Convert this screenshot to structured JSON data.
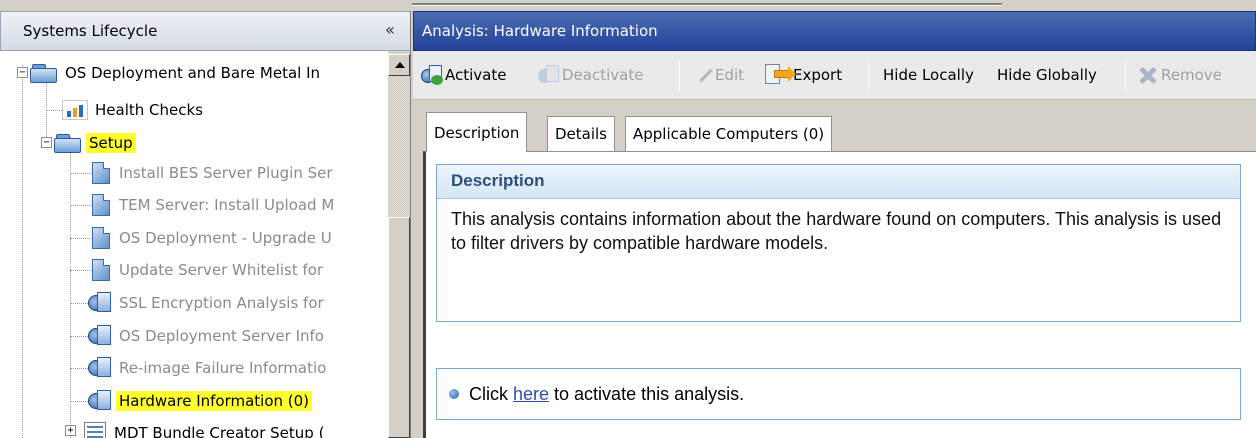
{
  "left_panel": {
    "title": "Systems Lifecycle",
    "collapse_glyph": "«",
    "tree": [
      {
        "label": "OS Deployment and Bare Metal In",
        "icon": "folder-icon",
        "expander": "−",
        "disabled": false,
        "highlight": false
      },
      {
        "label": "Health Checks",
        "icon": "chart-icon",
        "disabled": false,
        "highlight": false
      },
      {
        "label": "Setup",
        "icon": "folder-icon",
        "expander": "−",
        "disabled": false,
        "highlight": true
      },
      {
        "label": "Install BES Server Plugin Ser",
        "icon": "doc-icon",
        "disabled": true,
        "highlight": false
      },
      {
        "label": "TEM Server: Install Upload M",
        "icon": "doc-icon",
        "disabled": true,
        "highlight": false
      },
      {
        "label": "OS Deployment - Upgrade U",
        "icon": "doc-icon",
        "disabled": true,
        "highlight": false
      },
      {
        "label": "Update Server Whitelist for",
        "icon": "doc-icon",
        "disabled": true,
        "highlight": false
      },
      {
        "label": "SSL Encryption Analysis for",
        "icon": "analysis-icon",
        "disabled": true,
        "highlight": false
      },
      {
        "label": "OS Deployment Server Info",
        "icon": "analysis-icon",
        "disabled": true,
        "highlight": false
      },
      {
        "label": "Re-image Failure Informatio",
        "icon": "analysis-icon",
        "disabled": true,
        "highlight": false
      },
      {
        "label": "Hardware Information (0)",
        "icon": "analysis-icon",
        "disabled": false,
        "highlight": true
      },
      {
        "label": "MDT Bundle Creator Setup (",
        "icon": "bundle-icon",
        "expander": "+",
        "disabled": false,
        "highlight": false
      }
    ]
  },
  "right_panel": {
    "title": "Analysis: Hardware Information",
    "toolbar": {
      "activate": "Activate",
      "deactivate": "Deactivate",
      "edit": "Edit",
      "export": "Export",
      "hide_locally": "Hide Locally",
      "hide_globally": "Hide Globally",
      "remove": "Remove"
    },
    "tabs": [
      {
        "label": "Description",
        "active": true
      },
      {
        "label": "Details",
        "active": false
      },
      {
        "label": "Applicable Computers (0)",
        "active": false
      }
    ],
    "description": {
      "heading": "Description",
      "text": "This analysis contains information about the hardware found on computers. This analysis is used to filter drivers by compatible hardware models."
    },
    "action": {
      "prefix": "Click ",
      "link": "here",
      "suffix": " to activate this analysis."
    }
  },
  "colors": {
    "header_blue": "#22429b",
    "highlight_yellow": "#ffff2e",
    "box_border": "#7aa6d8",
    "link": "#2b4fa8"
  }
}
